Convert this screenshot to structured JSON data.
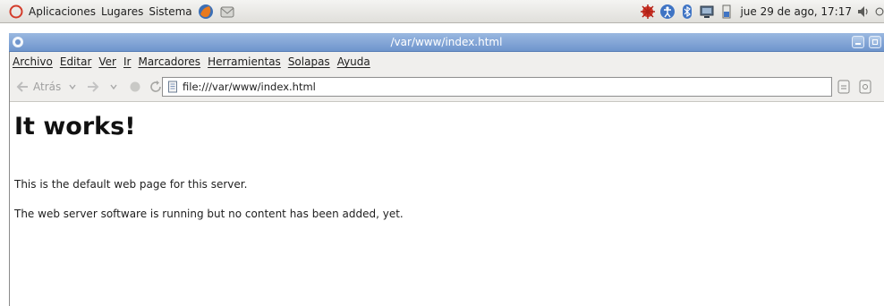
{
  "panel": {
    "menus": [
      "Aplicaciones",
      "Lugares",
      "Sistema"
    ],
    "clock": "jue 29 de ago, 17:17"
  },
  "window": {
    "title": "/var/www/index.html"
  },
  "menubar": {
    "items": [
      "Archivo",
      "Editar",
      "Ver",
      "Ir",
      "Marcadores",
      "Herramientas",
      "Solapas",
      "Ayuda"
    ]
  },
  "navbar": {
    "back_label": "Atrás",
    "url": "file:///var/www/index.html"
  },
  "page": {
    "heading": "It works!",
    "paragraphs": [
      "This is the default web page for this server.",
      "The web server software is running but no content has been added, yet."
    ]
  }
}
